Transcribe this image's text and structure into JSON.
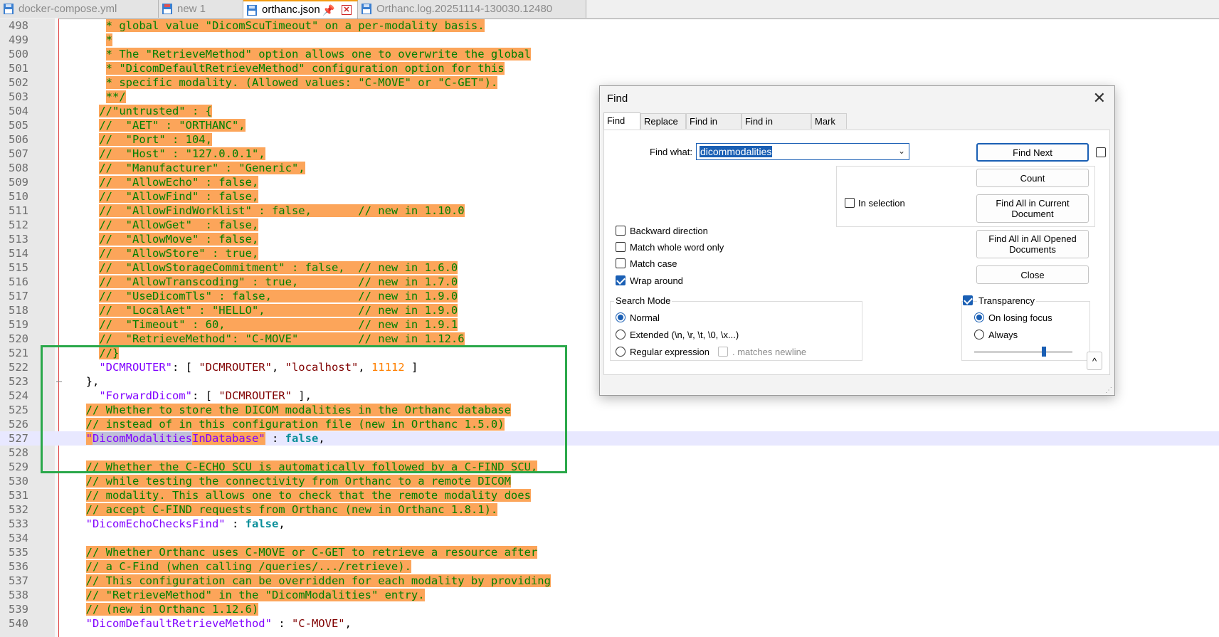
{
  "tabs": [
    {
      "label": "docker-compose.yml",
      "active": false
    },
    {
      "label": "new 1",
      "active": false
    },
    {
      "label": "orthanc.json",
      "active": true
    },
    {
      "label": "Orthanc.log.20251114-130030.12480",
      "active": false
    }
  ],
  "tab_icons": {
    "pin": "pin-icon",
    "close": "close-icon"
  },
  "colors": {
    "highlight": "#fca55a",
    "comment": "#008000",
    "key": "#8000ff",
    "string": "#800000",
    "number": "#ff8000",
    "keyword": "#0a8f9a",
    "accent": "#1a5fb4",
    "annotation_box": "#2aa84a"
  },
  "editor": {
    "lines": [
      {
        "n": "498",
        "ind": "     ",
        "segs": [
          {
            "t": "* global value \"DicomScuTimeout\" on a per-modality basis.",
            "c": "hlcom"
          }
        ]
      },
      {
        "n": "499",
        "ind": "     ",
        "segs": [
          {
            "t": "*",
            "c": "hlcom"
          }
        ]
      },
      {
        "n": "500",
        "ind": "     ",
        "segs": [
          {
            "t": "* The \"RetrieveMethod\" option allows one to overwrite the global",
            "c": "hlcom"
          }
        ]
      },
      {
        "n": "501",
        "ind": "     ",
        "segs": [
          {
            "t": "* \"DicomDefaultRetrieveMethod\" configuration option for this",
            "c": "hlcom"
          }
        ]
      },
      {
        "n": "502",
        "ind": "     ",
        "segs": [
          {
            "t": "* specific modality. (Allowed values: \"C-MOVE\" or \"C-GET\").",
            "c": "hlcom"
          }
        ]
      },
      {
        "n": "503",
        "ind": "     ",
        "segs": [
          {
            "t": "**/",
            "c": "hlcom"
          }
        ]
      },
      {
        "n": "504",
        "ind": "    ",
        "segs": [
          {
            "t": "//\"untrusted\" : {",
            "c": "hlcom"
          }
        ]
      },
      {
        "n": "505",
        "ind": "    ",
        "segs": [
          {
            "t": "//  \"AET\" : \"ORTHANC\",",
            "c": "hlcom"
          }
        ]
      },
      {
        "n": "506",
        "ind": "    ",
        "segs": [
          {
            "t": "//  \"Port\" : 104,",
            "c": "hlcom"
          }
        ]
      },
      {
        "n": "507",
        "ind": "    ",
        "segs": [
          {
            "t": "//  \"Host\" : \"127.0.0.1\",",
            "c": "hlcom"
          }
        ]
      },
      {
        "n": "508",
        "ind": "    ",
        "segs": [
          {
            "t": "//  \"Manufacturer\" : \"Generic\",",
            "c": "hlcom"
          }
        ]
      },
      {
        "n": "509",
        "ind": "    ",
        "segs": [
          {
            "t": "//  \"AllowEcho\" : false,",
            "c": "hlcom"
          }
        ]
      },
      {
        "n": "510",
        "ind": "    ",
        "segs": [
          {
            "t": "//  \"AllowFind\" : false,",
            "c": "hlcom"
          }
        ]
      },
      {
        "n": "511",
        "ind": "    ",
        "segs": [
          {
            "t": "//  \"AllowFindWorklist\" : false,       // new in 1.10.0",
            "c": "hlcom"
          }
        ]
      },
      {
        "n": "512",
        "ind": "    ",
        "segs": [
          {
            "t": "//  \"AllowGet\"  : false,",
            "c": "hlcom"
          }
        ]
      },
      {
        "n": "513",
        "ind": "    ",
        "segs": [
          {
            "t": "//  \"AllowMove\" : false,",
            "c": "hlcom"
          }
        ]
      },
      {
        "n": "514",
        "ind": "    ",
        "segs": [
          {
            "t": "//  \"AllowStore\" : true,",
            "c": "hlcom"
          }
        ]
      },
      {
        "n": "515",
        "ind": "    ",
        "segs": [
          {
            "t": "//  \"AllowStorageCommitment\" : false,  // new in 1.6.0",
            "c": "hlcom"
          }
        ]
      },
      {
        "n": "516",
        "ind": "    ",
        "segs": [
          {
            "t": "//  \"AllowTranscoding\" : true,         // new in 1.7.0",
            "c": "hlcom"
          }
        ]
      },
      {
        "n": "517",
        "ind": "    ",
        "segs": [
          {
            "t": "//  \"UseDicomTls\" : false,             // new in 1.9.0",
            "c": "hlcom"
          }
        ]
      },
      {
        "n": "518",
        "ind": "    ",
        "segs": [
          {
            "t": "//  \"LocalAet\" : \"HELLO\",              // new in 1.9.0",
            "c": "hlcom"
          }
        ]
      },
      {
        "n": "519",
        "ind": "    ",
        "segs": [
          {
            "t": "//  \"Timeout\" : 60,                    // new in 1.9.1",
            "c": "hlcom"
          }
        ]
      },
      {
        "n": "520",
        "ind": "    ",
        "segs": [
          {
            "t": "//  \"RetrieveMethod\": \"C-MOVE\"         // new in 1.12.6",
            "c": "hlcom"
          }
        ]
      },
      {
        "n": "521",
        "ind": "    ",
        "segs": [
          {
            "t": "//}",
            "c": "hlcom"
          }
        ]
      },
      {
        "n": "522",
        "ind": "    ",
        "segs": [
          {
            "t": "\"DCMROUTER\"",
            "c": "c-key"
          },
          {
            "t": ": [ ",
            "c": "c-pun"
          },
          {
            "t": "\"DCMROUTER\"",
            "c": "c-str"
          },
          {
            "t": ", ",
            "c": "c-pun"
          },
          {
            "t": "\"localhost\"",
            "c": "c-str"
          },
          {
            "t": ", ",
            "c": "c-pun"
          },
          {
            "t": "11112",
            "c": "c-num"
          },
          {
            "t": " ]",
            "c": "c-pun"
          }
        ]
      },
      {
        "n": "523",
        "ind": "  ",
        "segs": [
          {
            "t": "},",
            "c": "c-pun"
          }
        ]
      },
      {
        "n": "524",
        "ind": "    ",
        "segs": [
          {
            "t": "\"ForwardDicom\"",
            "c": "c-key"
          },
          {
            "t": ": [ ",
            "c": "c-pun"
          },
          {
            "t": "\"DCMROUTER\"",
            "c": "c-str"
          },
          {
            "t": " ],",
            "c": "c-pun"
          }
        ]
      },
      {
        "n": "525",
        "ind": "  ",
        "segs": [
          {
            "t": "// Whether to store the DICOM modalities in the Orthanc database",
            "c": "hlcom"
          }
        ]
      },
      {
        "n": "526",
        "ind": "  ",
        "segs": [
          {
            "t": "// instead of in this configuration file (new in Orthanc 1.5.0)",
            "c": "hlcom"
          }
        ]
      },
      {
        "n": "527",
        "ind": "  ",
        "cur": true,
        "segs": [
          {
            "t": "\"",
            "c": "c-key hl"
          },
          {
            "t": "DicomModalities",
            "c": "c-key c-match"
          },
          {
            "t": "InDatabase\"",
            "c": "c-key hl"
          },
          {
            "t": " : ",
            "c": "c-pun"
          },
          {
            "t": "false",
            "c": "c-kw"
          },
          {
            "t": ",",
            "c": "c-pun"
          }
        ]
      },
      {
        "n": "528",
        "ind": "",
        "segs": []
      },
      {
        "n": "529",
        "ind": "  ",
        "segs": [
          {
            "t": "// Whether the C-ECHO SCU is automatically followed by a C-FIND SCU,",
            "c": "hlcom"
          }
        ]
      },
      {
        "n": "530",
        "ind": "  ",
        "segs": [
          {
            "t": "// while testing the connectivity from Orthanc to a remote DICOM",
            "c": "hlcom"
          }
        ]
      },
      {
        "n": "531",
        "ind": "  ",
        "segs": [
          {
            "t": "// modality. This allows one to check that the remote modality does",
            "c": "hlcom"
          }
        ]
      },
      {
        "n": "532",
        "ind": "  ",
        "segs": [
          {
            "t": "// accept C-FIND requests from Orthanc (new in Orthanc 1.8.1).",
            "c": "hlcom"
          }
        ]
      },
      {
        "n": "533",
        "ind": "  ",
        "segs": [
          {
            "t": "\"DicomEchoChecksFind\"",
            "c": "c-key"
          },
          {
            "t": " : ",
            "c": "c-pun"
          },
          {
            "t": "false",
            "c": "c-kw"
          },
          {
            "t": ",",
            "c": "c-pun"
          }
        ]
      },
      {
        "n": "534",
        "ind": "",
        "segs": []
      },
      {
        "n": "535",
        "ind": "  ",
        "segs": [
          {
            "t": "// Whether Orthanc uses C-MOVE or C-GET to retrieve a resource after",
            "c": "hlcom"
          }
        ]
      },
      {
        "n": "536",
        "ind": "  ",
        "segs": [
          {
            "t": "// a C-Find (when calling /queries/.../retrieve).",
            "c": "hlcom"
          }
        ]
      },
      {
        "n": "537",
        "ind": "  ",
        "segs": [
          {
            "t": "// This configuration can be overridden for each modality by providing",
            "c": "hlcom"
          }
        ]
      },
      {
        "n": "538",
        "ind": "  ",
        "segs": [
          {
            "t": "// \"RetrieveMethod\" in the \"DicomModalities\" entry.",
            "c": "hlcom"
          }
        ]
      },
      {
        "n": "539",
        "ind": "  ",
        "segs": [
          {
            "t": "// (new in Orthanc 1.12.6)",
            "c": "hlcom"
          }
        ]
      },
      {
        "n": "540",
        "ind": "  ",
        "segs": [
          {
            "t": "\"DicomDefaultRetrieveMethod\"",
            "c": "c-key"
          },
          {
            "t": " : ",
            "c": "c-pun"
          },
          {
            "t": "\"C-MOVE\"",
            "c": "c-str"
          },
          {
            "t": ",",
            "c": "c-pun"
          }
        ]
      }
    ]
  },
  "find_dialog": {
    "title": "Find",
    "tabs": [
      "Find",
      "Replace",
      "Find in Files",
      "Find in Projects",
      "Mark"
    ],
    "find_what_label": "Find what:",
    "find_what_value": "dicommodalities",
    "in_selection_label": "In selection",
    "in_selection": false,
    "options": [
      {
        "label": "Backward direction",
        "checked": false
      },
      {
        "label": "Match whole word only",
        "checked": false
      },
      {
        "label": "Match case",
        "checked": false
      },
      {
        "label": "Wrap around",
        "checked": true
      }
    ],
    "search_mode_label": "Search Mode",
    "search_modes": [
      {
        "label": "Normal",
        "selected": true
      },
      {
        "label": "Extended (\\n, \\r, \\t, \\0, \\x...)",
        "selected": false
      },
      {
        "label": "Regular expression",
        "selected": false
      }
    ],
    "matches_newline_label": ". matches newline",
    "transparency_label": "Transparency",
    "transparency_enabled": true,
    "transparency_modes": [
      {
        "label": "On losing focus",
        "selected": true
      },
      {
        "label": "Always",
        "selected": false
      }
    ],
    "transparency_level": 0.72,
    "buttons": {
      "find_next": "Find Next",
      "count": "Count",
      "find_all_current": "Find All in Current Document",
      "find_all_opened": "Find All in All Opened Documents",
      "close": "Close"
    },
    "collapse_glyph": "^"
  }
}
